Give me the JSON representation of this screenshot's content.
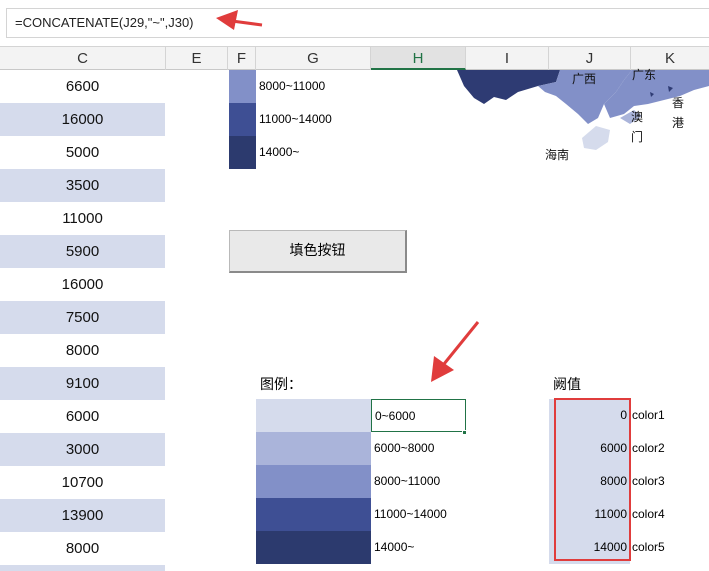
{
  "formula_bar": {
    "formula": "=CONCATENATE(J29,\"~\",J30)"
  },
  "columns": {
    "c": "C",
    "e": "E",
    "f": "F",
    "g": "G",
    "h": "H",
    "i": "I",
    "j": "J",
    "k": "K"
  },
  "column_c_values": [
    "6600",
    "16000",
    "5000",
    "3500",
    "11000",
    "5900",
    "16000",
    "7500",
    "8000",
    "9100",
    "6000",
    "3000",
    "10700",
    "13900",
    "8000"
  ],
  "top_legend": {
    "labels": [
      "8000~11000",
      "11000~14000",
      "14000~"
    ],
    "colors": [
      "#8290c8",
      "#3e4f94",
      "#2c3a6e"
    ]
  },
  "map": {
    "region_labels": {
      "guangxi": "广西",
      "guangdong": "广东",
      "hongkong_1": "香",
      "hongkong_2": "港",
      "macau_1": "澳",
      "macau_2": "门",
      "hainan": "海南"
    },
    "colors": {
      "dark": "#2e3b73",
      "mid": "#8290c8",
      "light": "#d5dbec"
    }
  },
  "button": {
    "label": "填色按钮"
  },
  "legend": {
    "title": "图例：",
    "items": [
      {
        "label": "0~6000",
        "color": "#d5dbec"
      },
      {
        "label": "6000~8000",
        "color": "#aab4da"
      },
      {
        "label": "8000~11000",
        "color": "#8290c8"
      },
      {
        "label": "11000~14000",
        "color": "#3e4f94"
      },
      {
        "label": "14000~",
        "color": "#2c3a6e"
      }
    ]
  },
  "threshold": {
    "title": "阙值",
    "values": [
      "0",
      "6000",
      "8000",
      "11000",
      "14000"
    ],
    "names": [
      "color1",
      "color2",
      "color3",
      "color4",
      "color5"
    ]
  },
  "annotation_color": "#e03c3c",
  "selection_color": "#217346"
}
